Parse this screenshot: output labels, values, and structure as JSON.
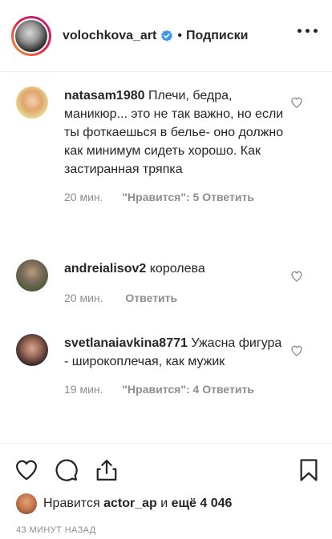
{
  "header": {
    "username": "volochkova_art",
    "separator": "•",
    "follow_label": "Подписки"
  },
  "comments": [
    {
      "username": "natasam1980",
      "text": "Плечи, бедра, маникюр... это не так важно, но если ты фоткаешься в белье- оно должно как минимум сидеть хорошо. Как застиранная тряпка",
      "time": "20 мин.",
      "likes": "\"Нравится\": 5",
      "reply": "Ответить"
    },
    {
      "username": "andreialisov2",
      "text": "королева",
      "time": "20 мин.",
      "likes": "",
      "reply": "Ответить"
    },
    {
      "username": "svetlanaiavkina8771",
      "text": "Ужасна фигура - широкоплечая, как мужик",
      "time": "19 мин.",
      "likes": "\"Нравится\": 4",
      "reply": "Ответить"
    }
  ],
  "likes_bar": {
    "prefix": "Нравится",
    "liker": "actor_ap",
    "conjunction": "и",
    "others": "ещё 4 046"
  },
  "timestamp": "43 МИНУТ НАЗАД",
  "icons": {
    "verified": "verified-badge-icon",
    "more": "more-options-icon",
    "like": "heart-icon",
    "comment": "comment-bubble-icon",
    "share": "share-icon",
    "save": "bookmark-icon"
  },
  "colors": {
    "text": "#262626",
    "secondary": "#8e8e8e",
    "verified": "#3897f0",
    "divider": "#efefef"
  }
}
